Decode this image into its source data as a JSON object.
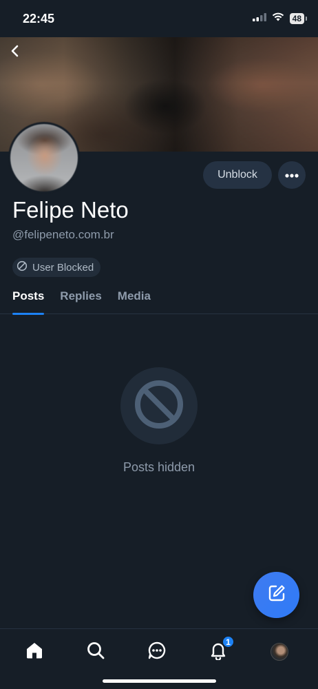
{
  "status_bar": {
    "time": "22:45",
    "battery": "48",
    "icons": [
      "cellular-signal-icon",
      "wifi-icon",
      "battery-icon"
    ]
  },
  "header": {
    "back_icon": "chevron-left-icon"
  },
  "profile": {
    "display_name": "Felipe Neto",
    "handle": "@felipeneto.com.br",
    "unblock_label": "Unblock",
    "more_icon": "ellipsis-icon",
    "blocked_label": "User Blocked"
  },
  "tabs": [
    {
      "label": "Posts",
      "active": true
    },
    {
      "label": "Replies",
      "active": false
    },
    {
      "label": "Media",
      "active": false
    }
  ],
  "empty_state": {
    "icon": "blocked-circle-icon",
    "text": "Posts hidden"
  },
  "compose": {
    "icon": "compose-icon"
  },
  "bottom_nav": {
    "items": [
      "home-icon",
      "search-icon",
      "chat-icon",
      "bell-icon",
      "avatar"
    ],
    "notification_count": "1"
  },
  "colors": {
    "background": "#161e27",
    "accent": "#1d82f5",
    "muted_text": "#8e9bab",
    "pill_bg": "#253243"
  }
}
